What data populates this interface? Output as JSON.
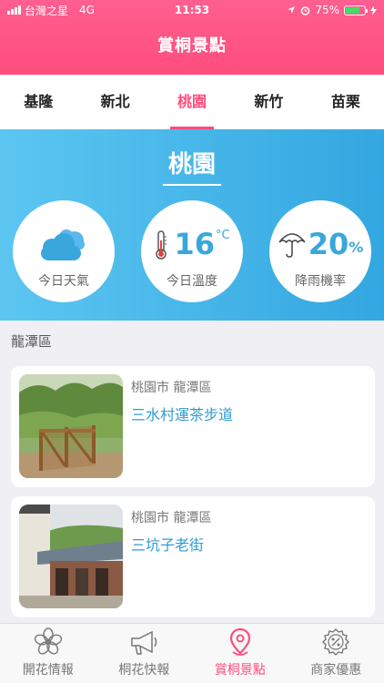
{
  "status_bar": {
    "carrier": "台灣之星",
    "network": "4G",
    "time": "11:53",
    "battery": "75%"
  },
  "header": {
    "title": "賞桐景點"
  },
  "tabs": [
    {
      "label": "基隆"
    },
    {
      "label": "新北"
    },
    {
      "label": "桃園"
    },
    {
      "label": "新竹"
    },
    {
      "label": "苗栗"
    }
  ],
  "active_tab": "桃園",
  "weather": {
    "city": "桃園",
    "today_weather_label": "今日天氣",
    "temperature": "16",
    "temperature_unit": "°C",
    "temperature_label": "今日溫度",
    "rain_chance": "20",
    "rain_unit": "%",
    "rain_label": "降雨機率"
  },
  "section": {
    "title": "龍潭區"
  },
  "spots": [
    {
      "location": "桃園市 龍潭區",
      "name": "三水村運茶步道"
    },
    {
      "location": "桃園市 龍潭區",
      "name": "三坑子老街"
    }
  ],
  "bottom_nav": [
    {
      "label": "開花情報",
      "icon": "flower-icon"
    },
    {
      "label": "桐花快報",
      "icon": "megaphone-icon"
    },
    {
      "label": "賞桐景點",
      "icon": "location-pin-icon"
    },
    {
      "label": "商家優惠",
      "icon": "discount-badge-icon"
    }
  ],
  "colors": {
    "brand": "#ff4d7d",
    "weather_bg": "#3aa7e1",
    "accent_text": "#2e9cd1"
  }
}
